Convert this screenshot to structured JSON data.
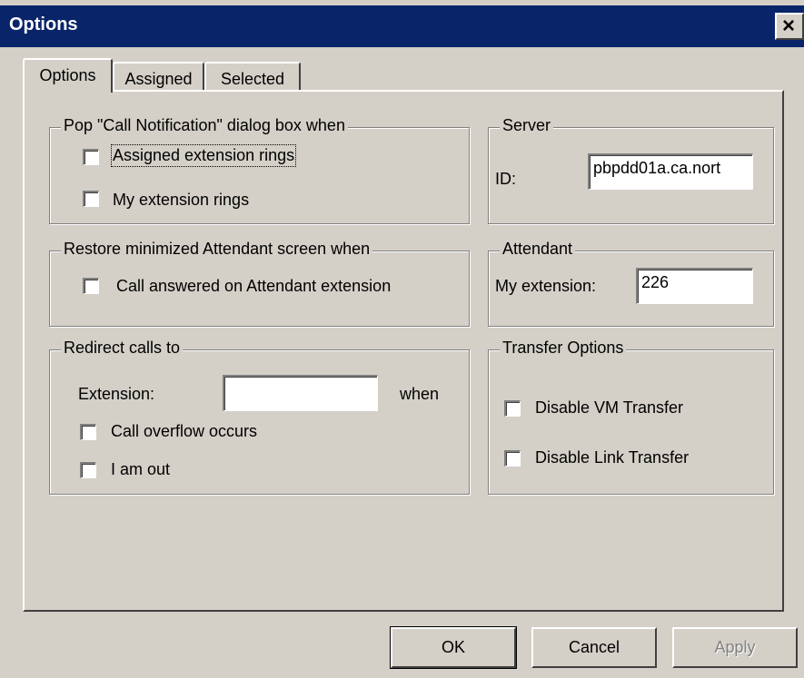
{
  "window": {
    "title": "Options",
    "close_glyph": "×",
    "close_icon": "close-icon"
  },
  "tabs": [
    {
      "label": "Options",
      "active": true
    },
    {
      "label": "Assigned",
      "active": false
    },
    {
      "label": "Selected",
      "active": false
    }
  ],
  "pop_group": {
    "title": "Pop \"Call Notification\" dialog box when",
    "assigned_ext_label": "Assigned extension rings",
    "assigned_ext_checked": false,
    "my_ext_label": "My extension rings",
    "my_ext_checked": false
  },
  "restore_group": {
    "title": "Restore minimized Attendant screen when",
    "call_answered_label": "Call answered on Attendant extension",
    "call_answered_checked": false
  },
  "redirect_group": {
    "title": "Redirect calls to",
    "extension_label": "Extension:",
    "extension_value": "",
    "when_label": "when",
    "overflow_label": "Call overflow occurs",
    "overflow_checked": false,
    "out_label": "I am out",
    "out_checked": false
  },
  "server_group": {
    "title": "Server",
    "id_label": "ID:",
    "id_value": "pbpdd01a.ca.nort"
  },
  "attendant_group": {
    "title": "Attendant",
    "my_ext_label": "My extension:",
    "my_ext_value": "226"
  },
  "transfer_group": {
    "title": "Transfer Options",
    "disable_vm_label": "Disable VM Transfer",
    "disable_vm_checked": false,
    "disable_link_label": "Disable Link Transfer",
    "disable_link_checked": false
  },
  "buttons": {
    "ok": "OK",
    "cancel": "Cancel",
    "apply": "Apply"
  },
  "colors": {
    "titlebar": "#0a246a",
    "face": "#d4d0c8"
  }
}
